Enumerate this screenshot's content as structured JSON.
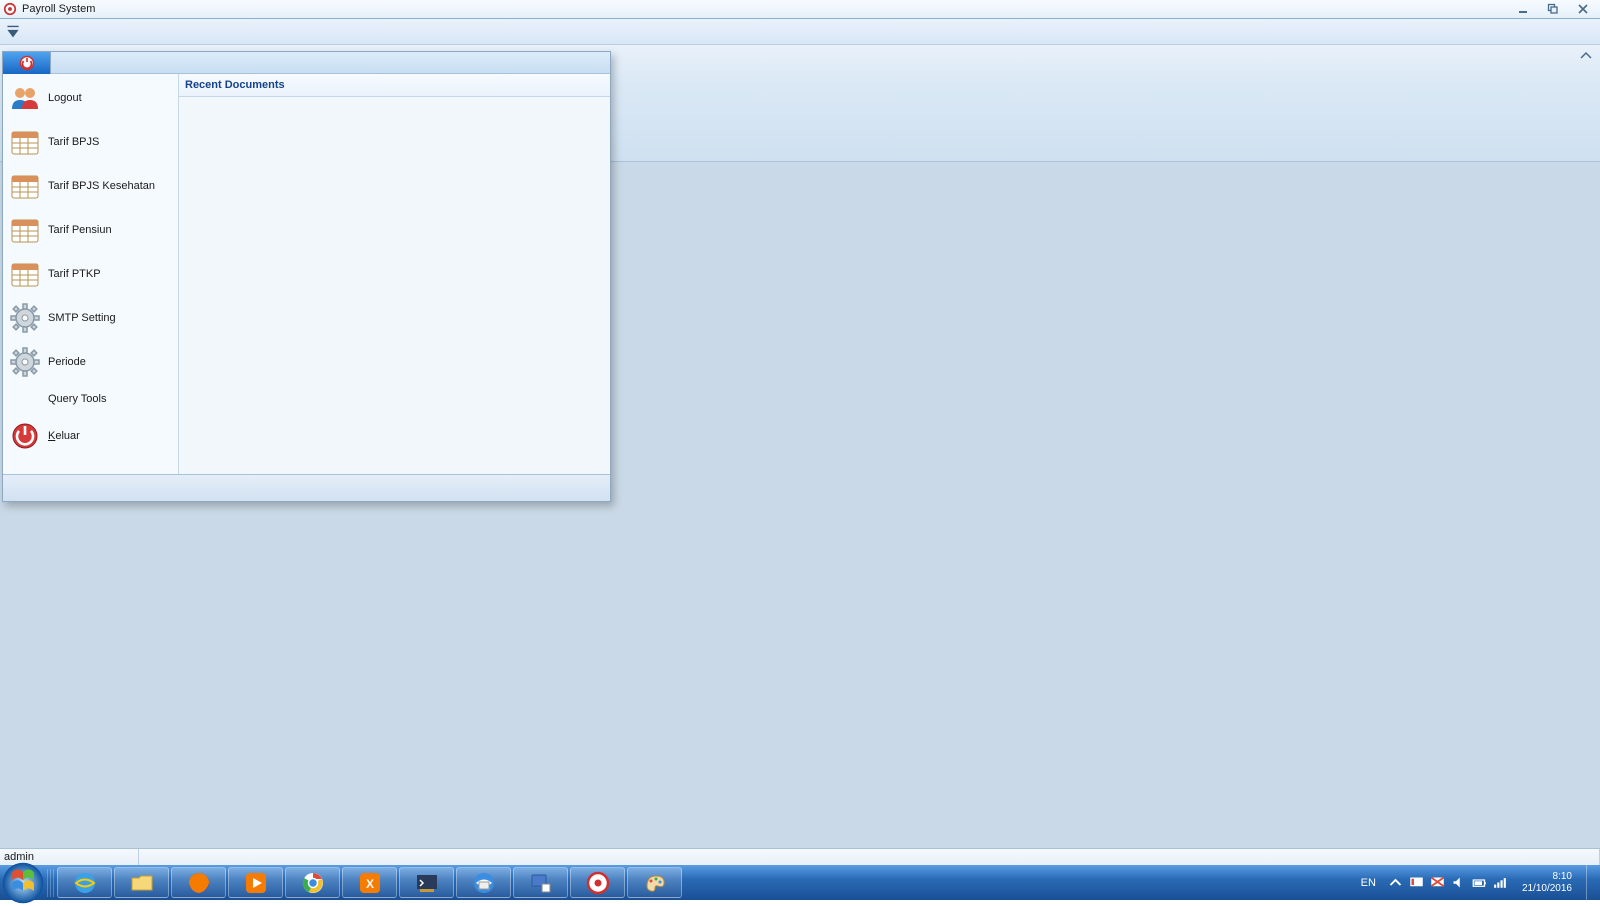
{
  "window": {
    "title": "Payroll System"
  },
  "app_menu": {
    "items": [
      {
        "label": "Logout",
        "icon": "users"
      },
      {
        "label": "Tarif BPJS",
        "icon": "calendar"
      },
      {
        "label": "Tarif BPJS Kesehatan",
        "icon": "calendar"
      },
      {
        "label": "Tarif Pensiun",
        "icon": "calendar"
      },
      {
        "label": "Tarif PTKP",
        "icon": "calendar"
      },
      {
        "label": "SMTP Setting",
        "icon": "gear"
      },
      {
        "label": "Periode",
        "icon": "gear"
      },
      {
        "label": "Query Tools",
        "icon": "none"
      },
      {
        "label": "Keluar",
        "icon": "power"
      }
    ],
    "recent_header": "Recent Documents"
  },
  "statusbar": {
    "user": "admin"
  },
  "taskbar": {
    "apps": [
      "internet-explorer",
      "file-explorer",
      "firefox",
      "media-player",
      "chrome",
      "xampp",
      "terminal-ssh",
      "thunderbird",
      "device-app",
      "payroll-app",
      "paint"
    ]
  },
  "tray": {
    "language": "EN",
    "time": "8:10",
    "date": "21/10/2016"
  }
}
